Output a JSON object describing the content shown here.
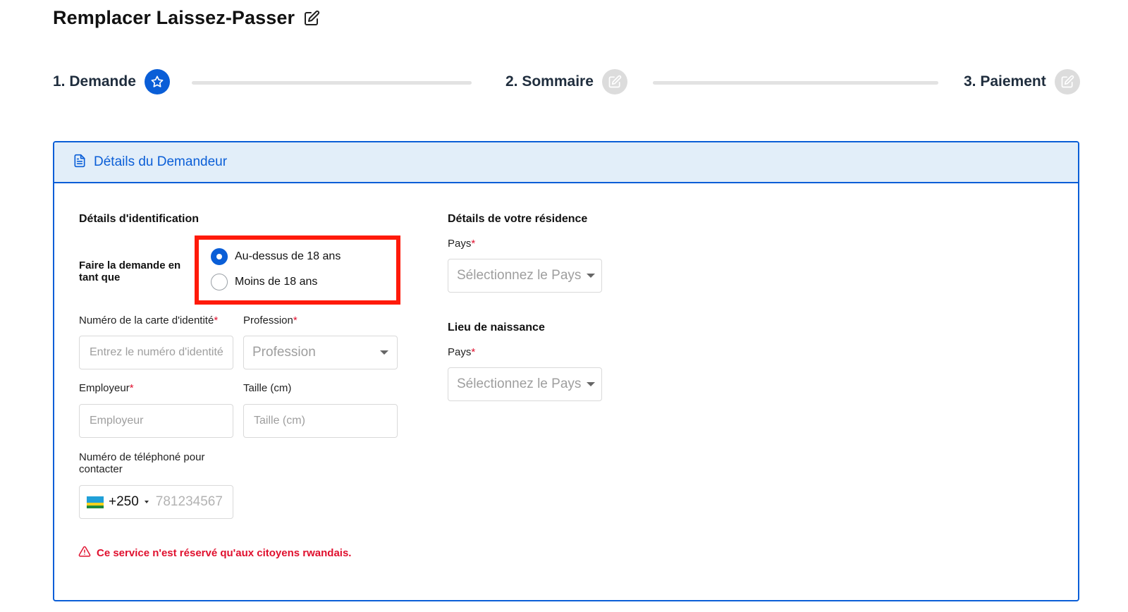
{
  "page": {
    "title": "Remplacer Laissez-Passer"
  },
  "stepper": {
    "steps": [
      {
        "label": "1. Demande",
        "state": "active"
      },
      {
        "label": "2. Sommaire",
        "state": "inactive"
      },
      {
        "label": "3. Paiement",
        "state": "inactive"
      }
    ]
  },
  "card": {
    "header": "Détails du Demandeur"
  },
  "identification": {
    "title": "Détails d'identification",
    "apply_as_label": "Faire la demande en tant que",
    "options": [
      {
        "label": "Au-dessus de 18 ans",
        "checked": true
      },
      {
        "label": "Moins de 18 ans",
        "checked": false
      }
    ]
  },
  "fields": {
    "id_card": {
      "label": "Numéro de la carte d'identité",
      "required_mark": "*",
      "placeholder": "Entrez le numéro d'identité"
    },
    "profession": {
      "label": "Profession",
      "required_mark": "*",
      "placeholder": "Profession"
    },
    "employer": {
      "label": "Employeur",
      "required_mark": "*",
      "placeholder": "Employeur"
    },
    "height": {
      "label": "Taille (cm)",
      "placeholder": "Taille (cm)"
    },
    "phone": {
      "label": "Numéro de téléphoné pour contacter",
      "dial_code": "+250",
      "placeholder": "781234567",
      "flag": "rwanda-flag"
    }
  },
  "residence": {
    "title": "Détails de votre résidence",
    "country_label": "Pays",
    "required_mark": "*",
    "country_placeholder": "Sélectionnez le Pays"
  },
  "birthplace": {
    "title": "Lieu de naissance",
    "country_label": "Pays",
    "required_mark": "*",
    "country_placeholder": "Sélectionnez le Pays"
  },
  "warning": {
    "text": "Ce service n'est réservé qu'aux citoyens rwandais."
  },
  "colors": {
    "primary": "#0a5ed7",
    "header_bg": "#e2eef9",
    "required": "#e0102e",
    "highlight_box": "#ff1a0a",
    "step_inactive": "#dcdcdc"
  }
}
